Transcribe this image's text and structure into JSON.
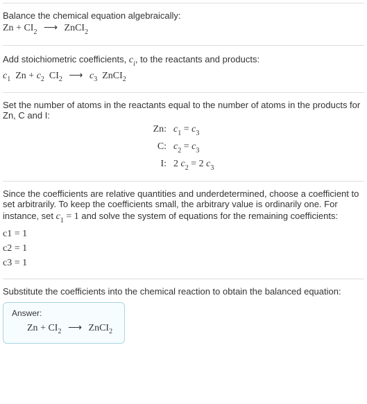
{
  "s1": {
    "intro": "Balance the chemical equation algebraically:",
    "r1": "Zn",
    "plus": " + ",
    "r2": "CI",
    "r2sub": "2",
    "arrow": "⟶",
    "p1": "ZnCI",
    "p1sub": "2"
  },
  "s2": {
    "intro_a": "Add stoichiometric coefficients, ",
    "cvar": "c",
    "csub": "i",
    "intro_b": ", to the reactants and products:",
    "c1": "c",
    "c1i": "1",
    "c2": "c",
    "c2i": "2",
    "c3": "c",
    "c3i": "3",
    "r1": "Zn",
    "r2": "CI",
    "r2sub": "2",
    "p1": "ZnCI",
    "p1sub": "2",
    "plus": " + ",
    "arrow": "⟶"
  },
  "s3": {
    "intro": "Set the number of atoms in the reactants equal to the number of atoms in the products for Zn, C and I:",
    "rows": [
      {
        "el": "Zn:",
        "c_a": "c",
        "ia": "1",
        "eq": " = ",
        "c_b": "c",
        "ib": "3"
      },
      {
        "el": "C:",
        "c_a": "c",
        "ia": "2",
        "eq": " = ",
        "c_b": "c",
        "ib": "3"
      },
      {
        "el": "I:",
        "ma": "2 ",
        "c_a": "c",
        "ia": "2",
        "eq": " = ",
        "mb": "2 ",
        "c_b": "c",
        "ib": "3"
      }
    ]
  },
  "s4": {
    "intro_a": "Since the coefficients are relative quantities and underdetermined, choose a coefficient to set arbitrarily. To keep the coefficients small, the arbitrary value is ordinarily one. For instance, set ",
    "c": "c",
    "ci": "1",
    "assign": " = 1",
    "intro_b": " and solve the system of equations for the remaining coefficients:",
    "lines": [
      {
        "c": "c",
        "i": "1",
        "v": " = 1"
      },
      {
        "c": "c",
        "i": "2",
        "v": " = 1"
      },
      {
        "c": "c",
        "i": "3",
        "v": " = 1"
      }
    ]
  },
  "s5": {
    "intro": "Substitute the coefficients into the chemical reaction to obtain the balanced equation:",
    "answer_label": "Answer:",
    "r1": "Zn",
    "plus": " + ",
    "r2": "CI",
    "r2sub": "2",
    "arrow": "⟶",
    "p1": "ZnCI",
    "p1sub": "2"
  },
  "chart_data": {
    "type": "table",
    "title": "Stoichiometric balancing of Zn + CI2 → ZnCI2",
    "species": [
      "Zn",
      "CI2",
      "ZnCI2"
    ],
    "coefficient_vars": [
      "c1",
      "c2",
      "c3"
    ],
    "atom_balance": {
      "Zn": "c1 = c3",
      "C": "c2 = c3",
      "I": "2 c2 = 2 c3"
    },
    "solution": {
      "c1": 1,
      "c2": 1,
      "c3": 1
    },
    "balanced_equation": "Zn + CI2 ⟶ ZnCI2"
  }
}
